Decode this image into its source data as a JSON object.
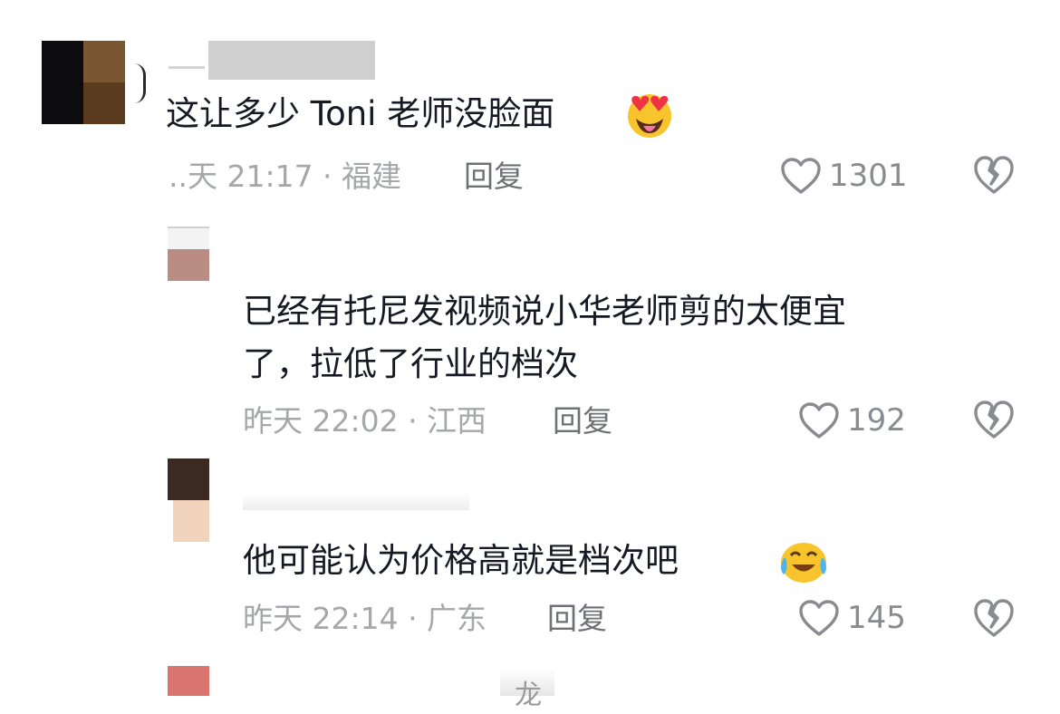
{
  "comments": [
    {
      "text": "这让多少 Toni 老师没脸面",
      "emoji": "heart-eyes-tongue-emoji",
      "time_location": "..天 21:17 · 福建",
      "reply_label": "回复",
      "like_count": "1301"
    },
    {
      "text_line1": "已经有托尼发视频说小华老师剪的太便宜",
      "text_line2": "了，拉低了行业的档次",
      "time_location": "昨天 22:02 · 江西",
      "reply_label": "回复",
      "like_count": "192"
    },
    {
      "text": "他可能认为价格高就是档次吧",
      "emoji": "crying-laughing-emoji",
      "time_location": "昨天 22:14 · 广东",
      "reply_label": "回复",
      "like_count": "145"
    },
    {
      "partial_name": "龙"
    }
  ],
  "icons": {
    "like": "heart-outline-icon",
    "dislike": "broken-heart-icon"
  },
  "colors": {
    "text": "#161823",
    "meta": "#a6a7ab",
    "reply": "#6f7075",
    "icon": "#8a8b90"
  }
}
